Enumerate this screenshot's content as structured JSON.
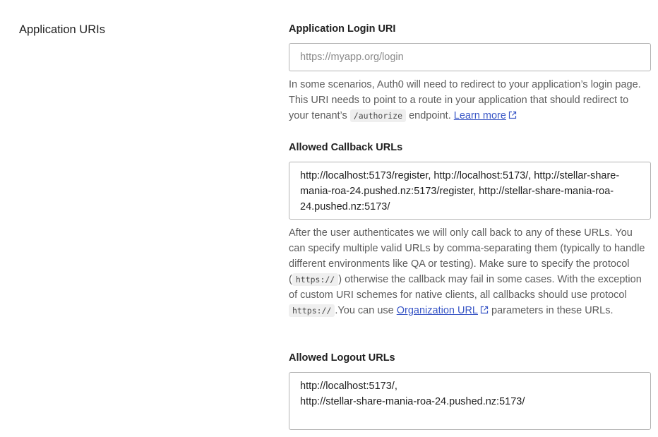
{
  "section": {
    "title": "Application URIs"
  },
  "login_uri": {
    "label": "Application Login URI",
    "placeholder": "https://myapp.org/login",
    "value": "",
    "help": {
      "part1": "In some scenarios, Auth0 will need to redirect to your application’s login page. This URI needs to point to a route in your application that should redirect to your tenant’s ",
      "code": "/authorize",
      "part2": " endpoint. ",
      "link_label": "Learn more"
    }
  },
  "callback_urls": {
    "label": "Allowed Callback URLs",
    "value": "http://localhost:5173/register, http://localhost:5173/, http://stellar-share-mania-roa-24.pushed.nz:5173/register, http://stellar-share-mania-roa-24.pushed.nz:5173/",
    "help": {
      "part1": "After the user authenticates we will only call back to any of these URLs. You can specify multiple valid URLs by comma-separating them (typically to handle different environments like QA or testing). Make sure to specify the protocol (",
      "code1": "https://",
      "part2": ") otherwise the callback may fail in some cases. With the exception of custom URI schemes for native clients, all callbacks should use protocol ",
      "code2": "https://",
      "part3": ".You can use ",
      "link_label": "Organization URL",
      "part4": " parameters in these URLs."
    }
  },
  "logout_urls": {
    "label": "Allowed Logout URLs",
    "value": "http://localhost:5173/,\nhttp://stellar-share-mania-roa-24.pushed.nz:5173/"
  },
  "colors": {
    "link": "#3a57c6",
    "help_text": "#5c5c5c",
    "border": "#b3b3b3",
    "code_bg": "#efefef"
  },
  "icons": {
    "external_link": "external-link-icon"
  }
}
